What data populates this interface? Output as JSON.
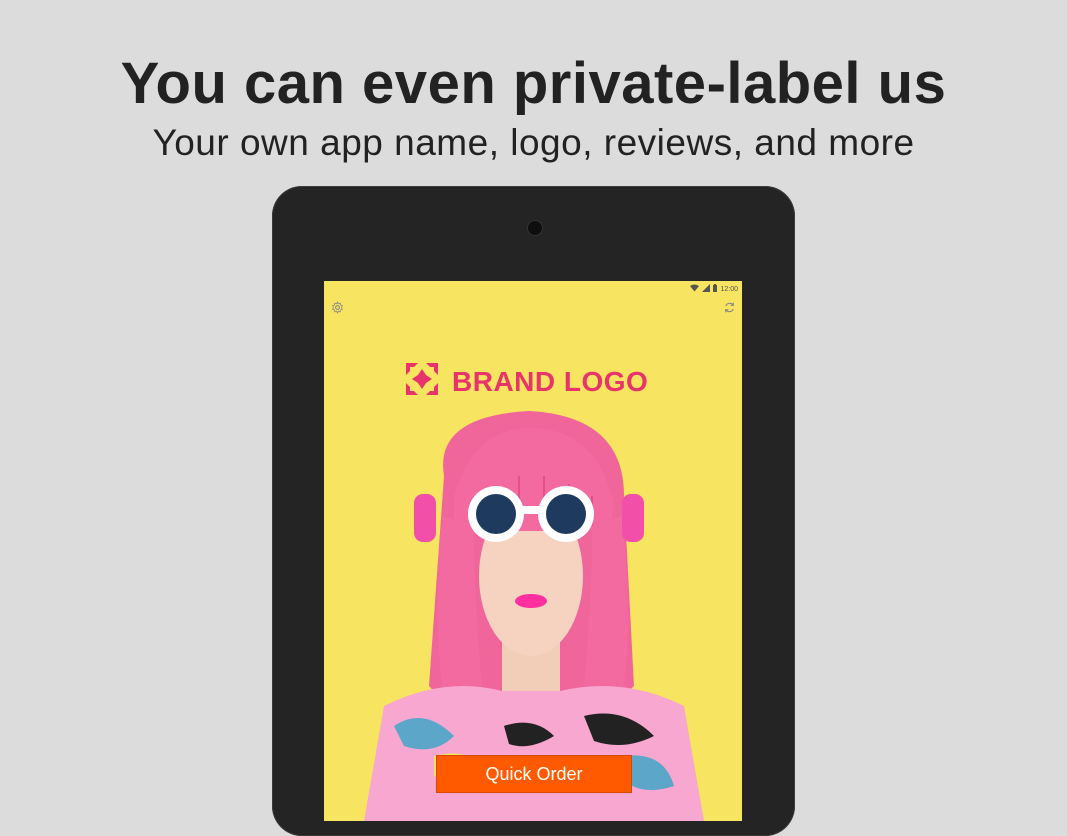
{
  "header": {
    "title": "You can even private-label us",
    "subtitle": "Your own app name, logo, reviews, and more"
  },
  "device": {
    "status_time": "12:00",
    "screen": {
      "settings_icon": "gear-icon",
      "refresh_icon": "refresh-icon",
      "brand_logo_text": "BRAND LOGO",
      "brand_color": "#e8336b",
      "background_color": "#f7e460",
      "cta_label": "Quick Order",
      "cta_color": "#ff5a00"
    }
  }
}
